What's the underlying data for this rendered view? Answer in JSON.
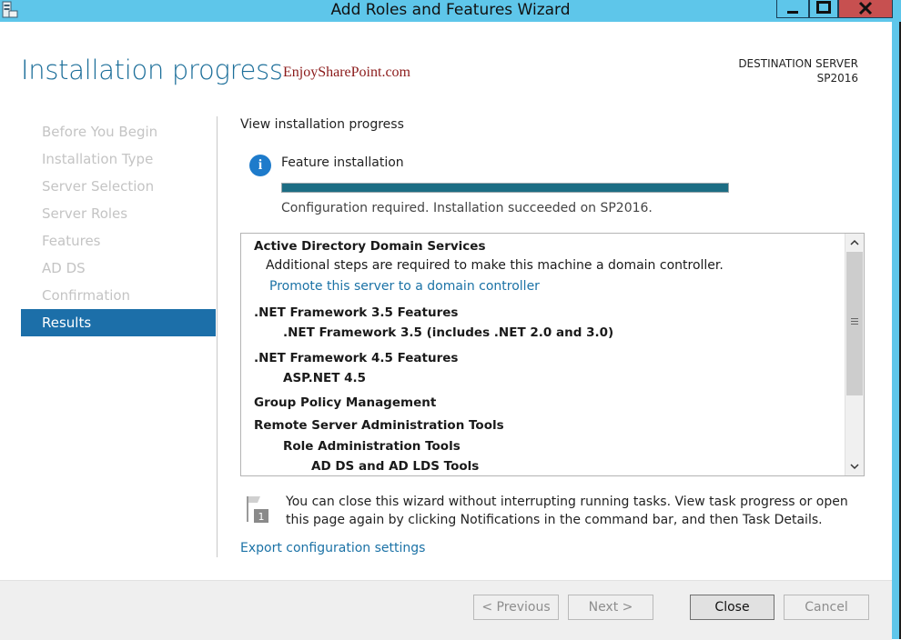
{
  "window": {
    "title": "Add Roles and Features Wizard",
    "controls": {
      "minimize_icon": "minimize-icon",
      "maximize_icon": "maximize-icon",
      "close_icon": "close-icon"
    }
  },
  "header": {
    "page_title": "Installation progress",
    "watermark": "EnjoySharePoint.com",
    "destination_label": "DESTINATION SERVER",
    "destination_name": "SP2016"
  },
  "nav": {
    "items": [
      {
        "label": "Before You Begin",
        "active": false
      },
      {
        "label": "Installation Type",
        "active": false
      },
      {
        "label": "Server Selection",
        "active": false
      },
      {
        "label": "Server Roles",
        "active": false
      },
      {
        "label": "Features",
        "active": false
      },
      {
        "label": "AD DS",
        "active": false
      },
      {
        "label": "Confirmation",
        "active": false
      },
      {
        "label": "Results",
        "active": true
      }
    ],
    "active_color": "#1c6fa9"
  },
  "main": {
    "view_label": "View installation progress",
    "feature_label": "Feature installation",
    "progress_fraction": 1.0,
    "progress_color": "#1c6d84",
    "status": "Configuration required. Installation succeeded on SP2016.",
    "results": [
      {
        "text": "Active Directory Domain Services",
        "kind": "bold"
      },
      {
        "text": "Additional steps are required to make this machine a domain controller.",
        "kind": "normal"
      },
      {
        "text": "Promote this server to a domain controller",
        "kind": "link"
      },
      {
        "text": ".NET Framework 3.5 Features",
        "kind": "bold"
      },
      {
        "text": ".NET Framework 3.5 (includes .NET 2.0 and 3.0)",
        "kind": "bold"
      },
      {
        "text": ".NET Framework 4.5 Features",
        "kind": "bold"
      },
      {
        "text": "ASP.NET 4.5",
        "kind": "bold"
      },
      {
        "text": "Group Policy Management",
        "kind": "bold"
      },
      {
        "text": "Remote Server Administration Tools",
        "kind": "bold"
      },
      {
        "text": "Role Administration Tools",
        "kind": "bold"
      },
      {
        "text": "AD DS and AD LDS Tools",
        "kind": "bold"
      }
    ],
    "note_badge": "1",
    "note_text": "You can close this wizard without interrupting running tasks. View task progress or open this page again by clicking Notifications in the command bar, and then Task Details.",
    "export_link": "Export configuration settings"
  },
  "footer": {
    "previous_label": "< Previous",
    "next_label": "Next >",
    "close_label": "Close",
    "cancel_label": "Cancel"
  }
}
